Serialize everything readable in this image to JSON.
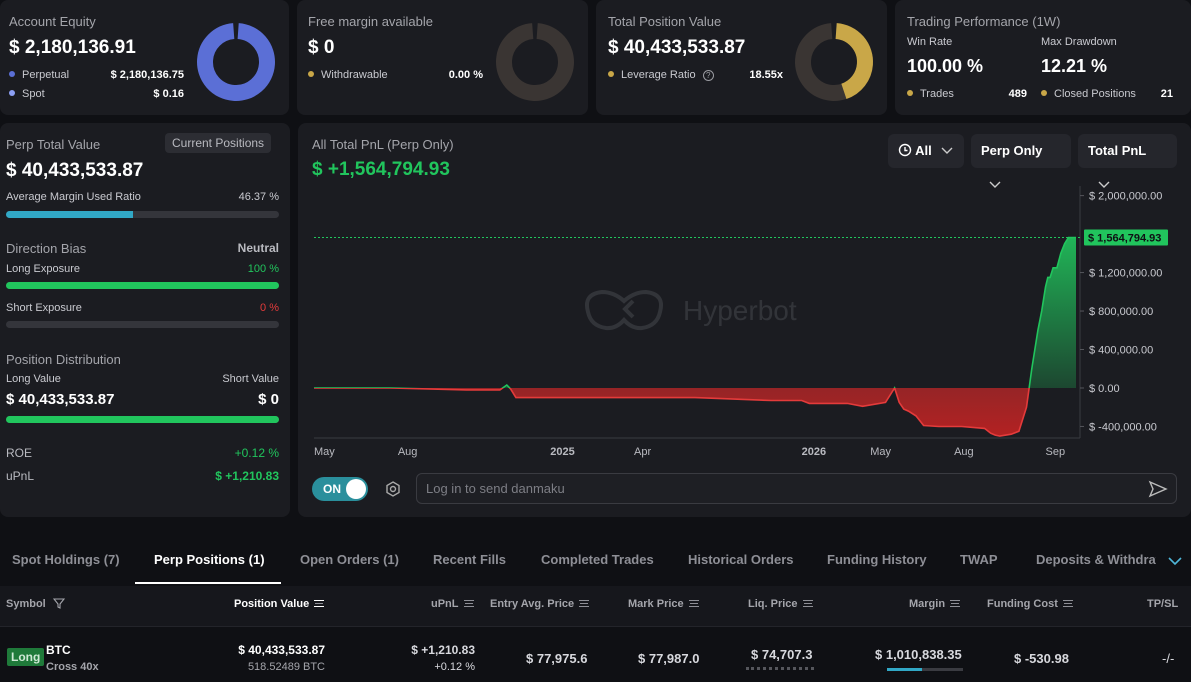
{
  "equity": {
    "title": "Account Equity",
    "value": "$ 2,180,136.91",
    "perp_label": "Perpetual",
    "perp_value": "$ 2,180,136.75",
    "spot_label": "Spot",
    "spot_value": "$ 0.16",
    "perp_color": "#5b6fd6",
    "spot_color": "#8da0f5"
  },
  "margin": {
    "title": "Free margin available",
    "value": "$ 0",
    "withdraw_label": "Withdrawable",
    "withdraw_value": "0.00 %"
  },
  "position_value": {
    "title": "Total Position Value",
    "value": "$ 40,433,533.87",
    "leverage_label": "Leverage Ratio",
    "leverage_value": "18.55x",
    "gauge_color": "#c9a748"
  },
  "performance": {
    "title": "Trading Performance (1W)",
    "win_rate_label": "Win Rate",
    "win_rate": "100.00 %",
    "drawdown_label": "Max Drawdown",
    "drawdown": "12.21 %",
    "trades_label": "Trades",
    "trades": "489",
    "closed_label": "Closed Positions",
    "closed": "21"
  },
  "left": {
    "perp_total_label": "Perp Total Value",
    "current_positions_btn": "Current Positions",
    "perp_total_value": "$ 40,433,533.87",
    "margin_ratio_label": "Average Margin Used Ratio",
    "margin_ratio_value": "46.37 %",
    "margin_ratio_fraction": 0.4637,
    "direction_label": "Direction Bias",
    "direction_value": "Neutral",
    "long_exposure_label": "Long Exposure",
    "long_exposure_value": "100 %",
    "long_exposure_fraction": 1.0,
    "short_exposure_label": "Short Exposure",
    "short_exposure_value": "0 %",
    "short_exposure_fraction": 0,
    "distribution_label": "Position Distribution",
    "long_value_label": "Long Value",
    "short_value_label": "Short Value",
    "long_value": "$ 40,433,533.87",
    "short_value": "$ 0",
    "long_value_fraction": 1.0,
    "roe_label": "ROE",
    "roe_value": "+0.12 %",
    "upnl_label": "uPnL",
    "upnl_value": "$ +1,210.83"
  },
  "chart_panel": {
    "title": "All Total PnL (Perp Only)",
    "value": "$ +1,564,794.93",
    "range_btn": "All",
    "scope_btn": "Perp Only",
    "metric_btn": "Total PnL",
    "watermark": "Hyperbot",
    "toggle_label": "ON",
    "danmaku_placeholder": "Log in to send danmaku"
  },
  "chart_data": {
    "type": "line",
    "y_ticks": [
      2000000,
      1200000,
      800000,
      400000,
      0,
      -400000
    ],
    "y_tick_labels": [
      "$ 2,000,000.00",
      "$ 1,200,000.00",
      "$ 800,000.00",
      "$ 400,000.00",
      "$ 0.00",
      "$ -400,000.00"
    ],
    "x_tick_labels": [
      "May",
      "Aug",
      "2025",
      "Apr",
      "2026",
      "May",
      "Aug",
      "Sep"
    ],
    "current_label": "$ 1,564,794.93",
    "current_value": 1564794.93,
    "ylim": [
      -520000,
      2100000
    ],
    "x": [
      0,
      10,
      20,
      24.4,
      25.3,
      25.8,
      26.5,
      30,
      40,
      50,
      60,
      64,
      65,
      70,
      72,
      75,
      76.2,
      76.8,
      77.4,
      78,
      79,
      80,
      82,
      85,
      88,
      88.8,
      89.4,
      90,
      90.8,
      91.5,
      92.5,
      93.5,
      94.2,
      95,
      95.5,
      96,
      96.3,
      96.6,
      97,
      97.5,
      98,
      98.5,
      99,
      99.5,
      100
    ],
    "y": [
      0,
      0,
      -20000,
      -20000,
      30000,
      -10000,
      -100000,
      -100000,
      -100000,
      -100000,
      -130000,
      -130000,
      -160000,
      -160000,
      -190000,
      -150000,
      0,
      -150000,
      -220000,
      -240000,
      -290000,
      -390000,
      -400000,
      -400000,
      -420000,
      -470000,
      -490000,
      -500000,
      -490000,
      -480000,
      -450000,
      -200000,
      200000,
      600000,
      800000,
      1050000,
      1150000,
      1150000,
      1250000,
      1250000,
      1400000,
      1500000,
      1564794,
      1564794,
      1564794
    ],
    "x_axis_note": "2024-05 to 2026-09"
  },
  "tabs": [
    "Spot Holdings (7)",
    "Perp Positions (1)",
    "Open Orders (1)",
    "Recent Fills",
    "Completed Trades",
    "Historical Orders",
    "Funding History",
    "TWAP",
    "Deposits & Withdraw"
  ],
  "table": {
    "headers": [
      "Symbol",
      "Position Value",
      "uPnL",
      "Entry Avg. Price",
      "Mark Price",
      "Liq. Price",
      "Margin",
      "Funding Cost",
      "TP/SL"
    ],
    "row": {
      "side": "Long",
      "symbol": "BTC",
      "mode": "Cross 40x",
      "position_value": "$ 40,433,533.87",
      "position_size": "518.52489 BTC",
      "upnl": "$ +1,210.83",
      "upnl_pct": "+0.12 %",
      "entry": "$ 77,975.6",
      "mark": "$ 77,987.0",
      "liq": "$ 74,707.3",
      "margin": "$ 1,010,838.35",
      "margin_fraction": 0.46,
      "funding": "$ -530.98",
      "tpsl": "-/-"
    }
  }
}
